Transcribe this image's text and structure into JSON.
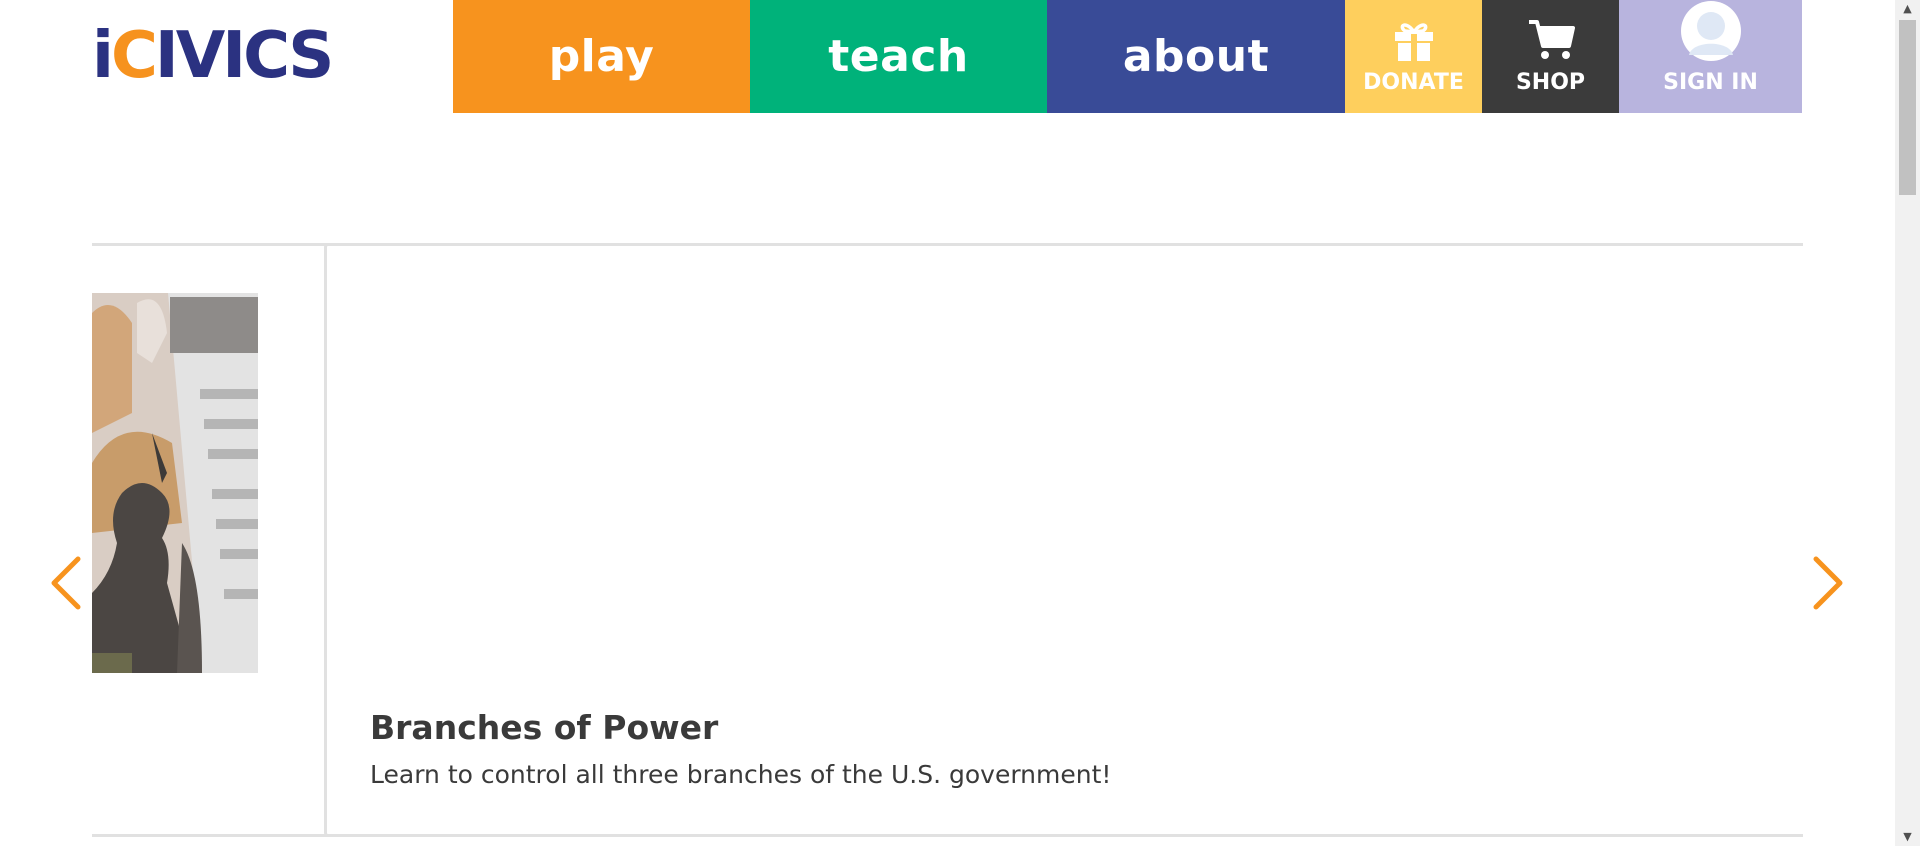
{
  "header": {
    "logo": {
      "text_i": "i",
      "text_c": "C",
      "text_rest": "IVICS"
    },
    "nav": {
      "play": "play",
      "teach": "teach",
      "about": "about",
      "donate": "DONATE",
      "shop": "SHOP",
      "sign_in": "SIGN IN"
    }
  },
  "carousel": {
    "main_card": {
      "title": "Branches of Power",
      "description": "Learn to control all three branches of the U.S. government!"
    }
  },
  "colors": {
    "brand_navy": "#2b3281",
    "play": "#f7931e",
    "teach": "#00b27a",
    "about": "#394b97",
    "donate": "#fecf5d",
    "shop": "#3b3b3b",
    "sign_in": "#b8b4de",
    "arrow": "#f7931e"
  },
  "icons": [
    "gift-icon",
    "cart-icon",
    "user-avatar-icon",
    "chevron-left-icon",
    "chevron-right-icon"
  ]
}
